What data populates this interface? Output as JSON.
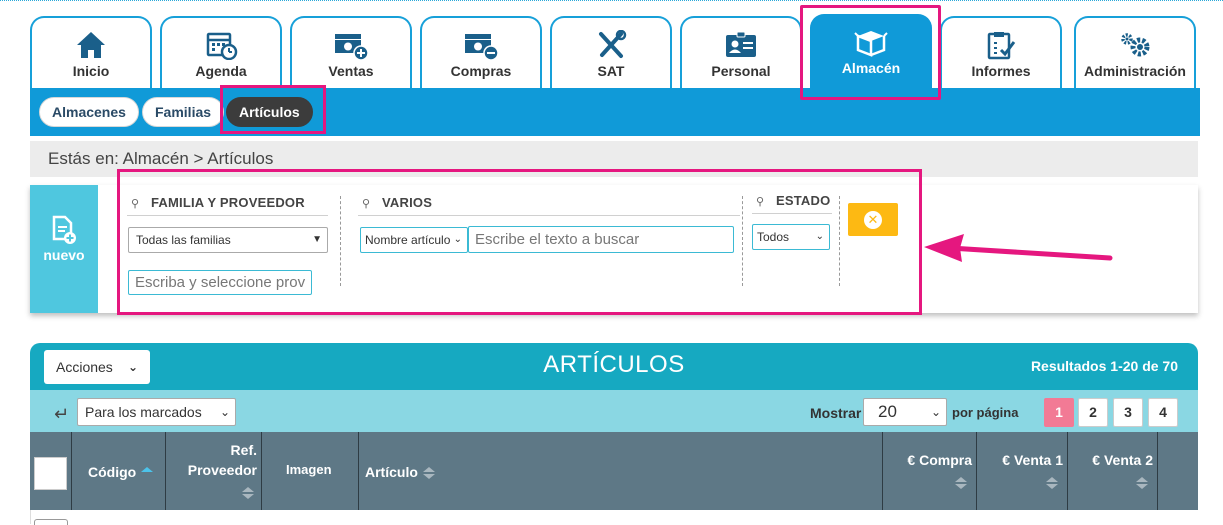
{
  "main_tabs": [
    {
      "label": "Inicio",
      "icon": "home-icon"
    },
    {
      "label": "Agenda",
      "icon": "calendar-icon"
    },
    {
      "label": "Ventas",
      "icon": "money-add-icon"
    },
    {
      "label": "Compras",
      "icon": "money-remove-icon"
    },
    {
      "label": "SAT",
      "icon": "tools-icon"
    },
    {
      "label": "Personal",
      "icon": "id-card-icon"
    },
    {
      "label": "Almacén",
      "icon": "boxes-icon",
      "active": true
    },
    {
      "label": "Informes",
      "icon": "clipboard-icon"
    },
    {
      "label": "Administración",
      "icon": "gears-icon"
    }
  ],
  "sub_tabs": [
    {
      "label": "Almacenes"
    },
    {
      "label": "Familias"
    },
    {
      "label": "Artículos",
      "active": true
    }
  ],
  "breadcrumb": "Estás en: Almacén > Artículos",
  "new_button": {
    "label": "nuevo"
  },
  "filters": {
    "familia_title": "FAMILIA Y PROVEEDOR",
    "familia_select": "Todas las familias",
    "proveedor_placeholder": "Escriba y seleccione prov",
    "varios_title": "VARIOS",
    "field_select": "Nombre artículo",
    "search_placeholder": "Escribe el texto a buscar",
    "estado_title": "ESTADO",
    "estado_select": "Todos"
  },
  "list": {
    "acciones_label": "Acciones",
    "title": "ARTÍCULOS",
    "results": "Resultados 1-20 de 70",
    "bulk_select": "Para los marcados",
    "mostrar_label": "Mostrar",
    "page_size": "20",
    "per_page_label": "por página",
    "pages": [
      "1",
      "2",
      "3",
      "4"
    ],
    "current_page": "1"
  },
  "columns": {
    "codigo": "Código",
    "ref_line1": "Ref.",
    "ref_line2": "Proveedor",
    "imagen": "Imagen",
    "articulo": "Artículo",
    "compra": "€ Compra",
    "venta1": "€ Venta 1",
    "venta2": "€ Venta 2"
  },
  "colors": {
    "brand_blue": "#109ad8",
    "highlight_pink": "#e5177f",
    "table_header": "#16a9c1",
    "clear_button": "#fdb913"
  }
}
